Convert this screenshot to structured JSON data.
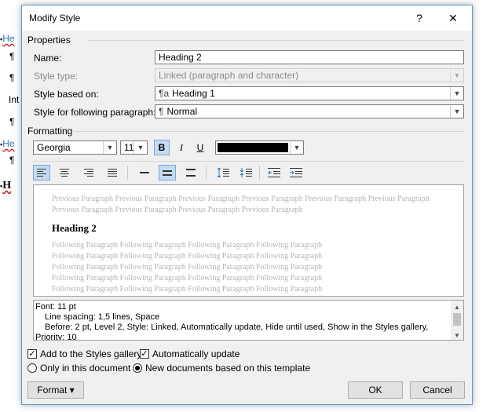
{
  "background_doc": {
    "lines": [
      {
        "prefix": "▪",
        "text": "He",
        "style": "link"
      },
      {
        "prefix": "",
        "text": "¶",
        "style": "plain"
      },
      {
        "prefix": "",
        "text": "¶",
        "style": "plain"
      },
      {
        "prefix": "",
        "text": "Int",
        "style": "plain"
      },
      {
        "prefix": "",
        "text": "¶",
        "style": "plain"
      },
      {
        "prefix": "▪",
        "text": "He",
        "style": "link"
      },
      {
        "prefix": "",
        "text": "¶",
        "style": "plain"
      },
      {
        "prefix": "▪",
        "text": "H",
        "style": "bold"
      }
    ]
  },
  "dialog": {
    "title": "Modify Style",
    "help_label": "?",
    "close_label": "✕",
    "properties": {
      "section_label": "Properties",
      "name_label": "Name:",
      "name_value": "Heading 2",
      "style_type_label": "Style type:",
      "style_type_value": "Linked (paragraph and character)",
      "based_on_label": "Style based on:",
      "based_on_glyph": "¶a",
      "based_on_value": "Heading 1",
      "following_label": "Style for following paragraph:",
      "following_glyph": "¶",
      "following_value": "Normal"
    },
    "formatting": {
      "section_label": "Formatting",
      "font_name": "Georgia",
      "font_size": "11",
      "bold_label": "B",
      "italic_label": "I",
      "underline_label": "U",
      "font_color": "#000000"
    },
    "preview": {
      "previous_text": "Previous Paragraph Previous Paragraph Previous Paragraph Previous Paragraph Previous Paragraph Previous Paragraph Previous Paragraph Previous Paragraph Previous Paragraph Previous Paragraph",
      "heading_text": "Heading 2",
      "following_lines": [
        "Following Paragraph Following Paragraph Following Paragraph Following Paragraph",
        "Following Paragraph Following Paragraph Following Paragraph Following Paragraph",
        "Following Paragraph Following Paragraph Following Paragraph Following Paragraph",
        "Following Paragraph Following Paragraph Following Paragraph Following Paragraph",
        "Following Paragraph Following Paragraph Following Paragraph Following Paragraph"
      ]
    },
    "description": {
      "line1": "Font: 11 pt",
      "line2": "Line spacing:  1,5 lines, Space",
      "line3": "Before:  2 pt, Level 2, Style: Linked, Automatically update, Hide until used, Show in the Styles gallery,",
      "line4": "Priority: 10"
    },
    "options": {
      "add_to_gallery_label": "Add to the Styles gallery",
      "add_to_gallery_checked": true,
      "auto_update_label": "Automatically update",
      "auto_update_checked": true,
      "only_doc_label": "Only in this document",
      "new_docs_label": "New documents based on this template",
      "selected_scope": "new_docs"
    },
    "buttons": {
      "format_label": "Format ▾",
      "ok_label": "OK",
      "cancel_label": "Cancel"
    }
  }
}
